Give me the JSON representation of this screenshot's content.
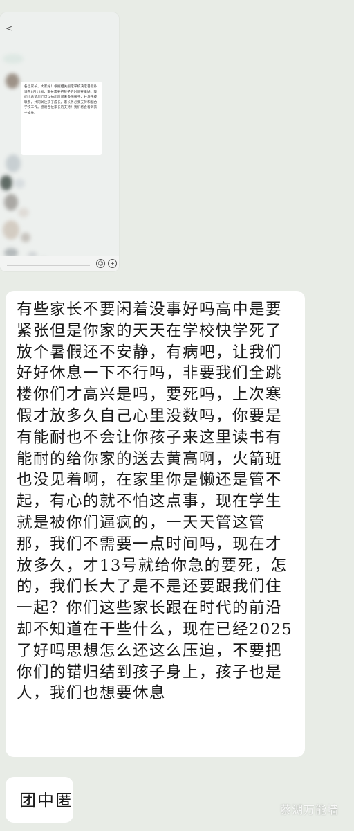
{
  "embedded_screenshot": {
    "back_symbol": "<",
    "message_text": "各位家长，大家好！根据相关规定学校决定暑假补课至8月13号，家长需要把孩子的时间安排好。我们也希望您们可以抽出时间来多陪孩子，并与学校联系，共同关注孩子成长。家长务必要支持和配合学校工作。感谢各位家长的支持！我们将会看到孩子成长。",
    "emoji_icon": "☺",
    "plus_icon": "+"
  },
  "message": {
    "text": "有些家长不要闲着没事好吗高中是要紧张但是你家的天天在学校快学死了放个暑假还不安静，有病吧，让我们好好休息一下不行吗，非要我们全跳楼你们才高兴是吗，要死吗，上次寒假才放多久自己心里没数吗，你要是有能耐也不会让你孩子来这里读书有能耐的给你家的送去黄高啊，火箭班也没见着啊，在家里你是懒还是管不起，有心的就不怕这点事，现在学生就是被你们逼疯的，一天天管这管那，我们不需要一点时间吗，现在才放多久，才13号就给你急的要死，怎的，我们长大了是不是还要跟我们住一起？你们这些家长跟在时代的前沿却不知道在干些什么，现在已经2025了好吗思想怎么还这么压迫，不要把你们的错归结到孩子身上，孩子也是人，我们也想要休息"
  },
  "reply": {
    "text": "团中匿"
  },
  "watermark": {
    "text": "蔡湖万能墙"
  },
  "colors": {
    "background": "#e8ece6",
    "bubble": "#ffffff",
    "text": "#1a1a1a"
  }
}
